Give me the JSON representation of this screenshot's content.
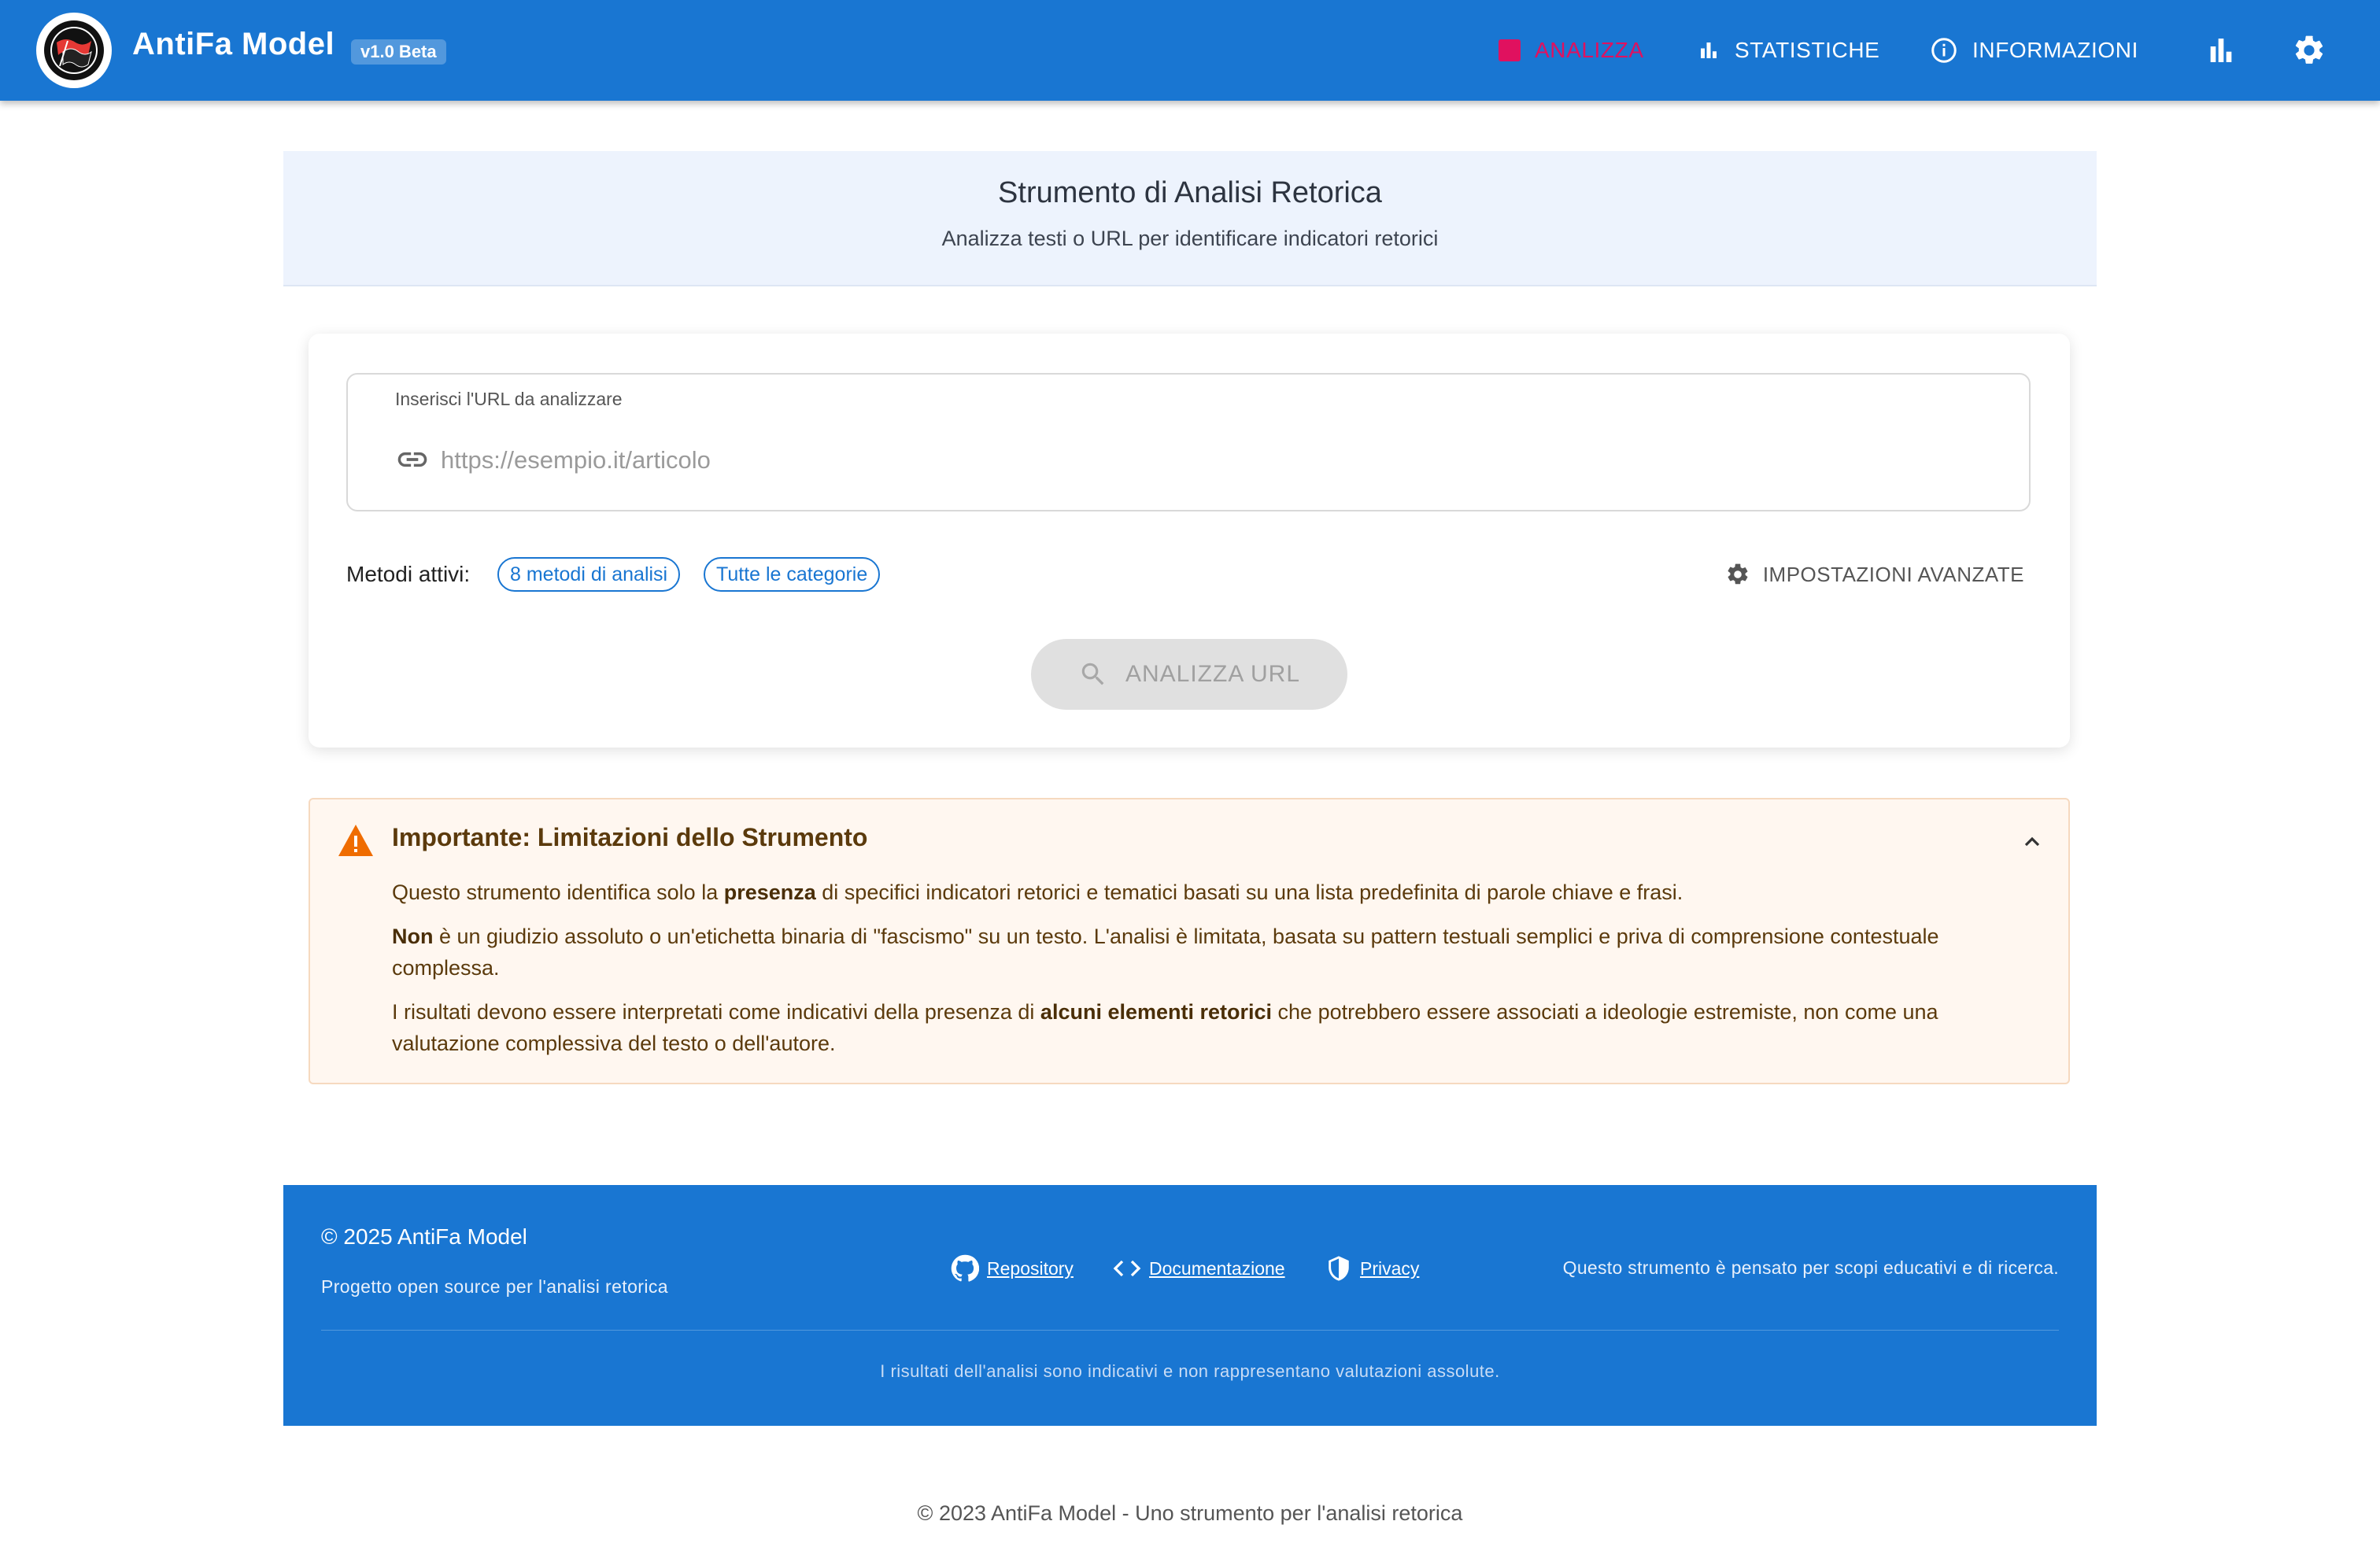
{
  "colors": {
    "primary": "#1976d2",
    "active_nav": "#e0115f",
    "hero_bg": "#edf3fd",
    "warning_bg": "#fff7f0",
    "warning_icon": "#ef6c00"
  },
  "appbar": {
    "brand": "AntiFa Model",
    "version": "v1.0 Beta",
    "nav": [
      {
        "label": "ANALIZZA",
        "icon": "analyze-square-icon",
        "active": true
      },
      {
        "label": "STATISTICHE",
        "icon": "bar-chart-icon",
        "active": false
      },
      {
        "label": "INFORMAZIONI",
        "icon": "info-icon",
        "active": false
      }
    ],
    "icons": [
      "bar-chart-icon",
      "gear-icon"
    ]
  },
  "hero": {
    "title": "Strumento di Analisi Retorica",
    "subtitle": "Analizza testi o URL per identificare indicatori retorici"
  },
  "form": {
    "url_label": "Inserisci l'URL da analizzare",
    "url_placeholder": "https://esempio.it/articolo",
    "url_value": "",
    "methods_label": "Metodi attivi:",
    "chips": [
      "8 metodi di analisi",
      "Tutte le categorie"
    ],
    "advanced_label": "IMPOSTAZIONI AVANZATE",
    "analyze_label": "ANALIZZA URL"
  },
  "warning": {
    "title": "Importante: Limitazioni dello Strumento",
    "p1_a": "Questo strumento identifica solo la ",
    "p1_b": "presenza",
    "p1_c": " di specifici indicatori retorici e tematici basati su una lista predefinita di parole chiave e frasi.",
    "p2_a": "Non",
    "p2_b": " è un giudizio assoluto o un'etichetta binaria di \"fascismo\" su un testo. L'analisi è limitata, basata su pattern testuali semplici e priva di comprensione contestuale complessa.",
    "p3_a": "I risultati devono essere interpretati come indicativi della presenza di ",
    "p3_b": "alcuni elementi retorici",
    "p3_c": " che potrebbero essere associati a ideologie estremiste, non come una valutazione complessiva del testo o dell'autore."
  },
  "footer": {
    "copyright": "© 2025 AntiFa Model",
    "project": "Progetto open source per l'analisi retorica",
    "links": [
      {
        "label": "Repository",
        "icon": "github-icon"
      },
      {
        "label": "Documentazione",
        "icon": "code-icon"
      },
      {
        "label": "Privacy",
        "icon": "shield-icon"
      }
    ],
    "note": "Questo strumento è pensato per scopi educativi e di ricerca.",
    "disclaimer": "I risultati dell'analisi sono indicativi e non rappresentano valutazioni assolute."
  },
  "page_footer": "© 2023 AntiFa Model - Uno strumento per l'analisi retorica"
}
